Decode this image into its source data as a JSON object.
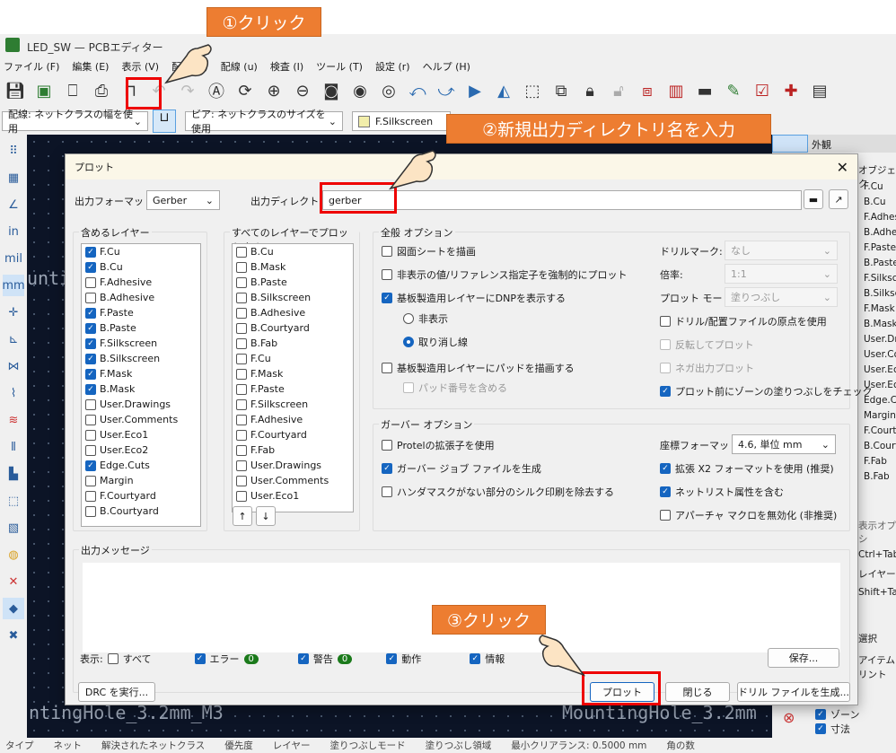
{
  "window": {
    "title": "LED_SW — PCBエディター"
  },
  "menu": [
    "ファイル (F)",
    "編集 (E)",
    "表示 (V)",
    "配置 (P)",
    "配線 (u)",
    "検査 (I)",
    "ツール (T)",
    "設定 (r)",
    "ヘルプ (H)"
  ],
  "toolbar2": {
    "track": "配線: ネットクラスの幅を使用",
    "via": "ビア: ネットクラスのサイズを使用",
    "layer": "F.Silkscreen",
    "layer_color": "#f2eeaa"
  },
  "left_toolbar": {
    "in": "in",
    "mil": "mil",
    "mm": "mm"
  },
  "canvas": {
    "label_left": "ntingHole_3.2mm_M3",
    "label_right": "MountingHole_3.2mm",
    "label_top": "unti"
  },
  "right_panel": {
    "header": "外観",
    "tab": "オブジェク",
    "layers": [
      "F.Cu",
      "B.Cu",
      "F.Adhes",
      "B.Adhes",
      "F.Paste",
      "B.Paste",
      "F.Silkscr",
      "B.Silksc",
      "F.Mask",
      "B.Mask",
      "User.Dr",
      "User.Co",
      "User.Ec",
      "User.Ec",
      "Edge.Cu",
      "Margin",
      "F.Courty",
      "B.Court",
      "F.Fab",
      "B.Fab"
    ],
    "display_opts": "表示オプシ",
    "ctrl_tab": "Ctrl+Tab",
    "layer": "レイヤー",
    "shift_tab": "Shift+Ta",
    "select": "選択",
    "items": "アイテム",
    "print": "リント",
    "zone": "ゾーン",
    "dim": "寸法"
  },
  "status": [
    "タイプ",
    "ネット",
    "解決されたネットクラス",
    "優先度",
    "レイヤー",
    "塗りつぶしモード",
    "塗りつぶし領域",
    "最小クリアランス: 0.5000 mm",
    "角の数"
  ],
  "dialog": {
    "title": "プロット",
    "format_label": "出力フォーマット:",
    "format": "Gerber",
    "dir_label": "出力ディレクトリ:",
    "dir": "gerber",
    "include_layers": {
      "label": "含めるレイヤー",
      "items": [
        {
          "name": "F.Cu",
          "checked": true
        },
        {
          "name": "B.Cu",
          "checked": true
        },
        {
          "name": "F.Adhesive",
          "checked": false
        },
        {
          "name": "B.Adhesive",
          "checked": false
        },
        {
          "name": "F.Paste",
          "checked": true
        },
        {
          "name": "B.Paste",
          "checked": true
        },
        {
          "name": "F.Silkscreen",
          "checked": true
        },
        {
          "name": "B.Silkscreen",
          "checked": true
        },
        {
          "name": "F.Mask",
          "checked": true
        },
        {
          "name": "B.Mask",
          "checked": true
        },
        {
          "name": "User.Drawings",
          "checked": false
        },
        {
          "name": "User.Comments",
          "checked": false
        },
        {
          "name": "User.Eco1",
          "checked": false
        },
        {
          "name": "User.Eco2",
          "checked": false
        },
        {
          "name": "Edge.Cuts",
          "checked": true
        },
        {
          "name": "Margin",
          "checked": false
        },
        {
          "name": "F.Courtyard",
          "checked": false
        },
        {
          "name": "B.Courtyard",
          "checked": false
        }
      ]
    },
    "all_layers": {
      "label": "すべてのレイヤーでプロットする",
      "items": [
        "B.Cu",
        "B.Mask",
        "B.Paste",
        "B.Silkscreen",
        "B.Adhesive",
        "B.Courtyard",
        "B.Fab",
        "F.Cu",
        "F.Mask",
        "F.Paste",
        "F.Silkscreen",
        "F.Adhesive",
        "F.Courtyard",
        "F.Fab",
        "User.Drawings",
        "User.Comments",
        "User.Eco1"
      ]
    },
    "general": {
      "label": "全般 オプション",
      "sheet": "図面シートを描画",
      "force": "非表示の値/リファレンス指定子を強制的にプロット",
      "dnp": "基板製造用レイヤーにDNPを表示する",
      "hide": "非表示",
      "strike": "取り消し線",
      "pads": "基板製造用レイヤーにパッドを描画する",
      "padnum": "パッド番号を含める",
      "drill_label": "ドリルマーク:",
      "drill": "なし",
      "scale_label": "倍率:",
      "scale": "1:1",
      "mode_label": "プロット モード:",
      "mode": "塗りつぶし",
      "origin": "ドリル/配置ファイルの原点を使用",
      "mirror": "反転してプロット",
      "negative": "ネガ出力プロット",
      "zone_check": "プロット前にゾーンの塗りつぶしをチェック"
    },
    "gerber": {
      "label": "ガーバー オプション",
      "protel": "Protelの拡張子を使用",
      "job": "ガーバー ジョブ ファイルを生成",
      "silk": "ハンダマスクがない部分のシルク印刷を除去する",
      "coord_label": "座標フォーマット:",
      "coord": "4.6, 単位 mm",
      "x2": "拡張 X2 フォーマットを使用 (推奨)",
      "netlist": "ネットリスト属性を含む",
      "aperture": "アパーチャ マクロを無効化 (非推奨)"
    },
    "messages": {
      "label": "出力メッセージ",
      "show": "表示:",
      "all": "すべて",
      "error": "エラー",
      "error_count": "0",
      "warn": "警告",
      "warn_count": "0",
      "action": "動作",
      "info": "情報",
      "save": "保存..."
    },
    "buttons": {
      "drc": "DRC を実行...",
      "plot": "プロット",
      "close": "閉じる",
      "drill": "ドリル ファイルを生成..."
    }
  },
  "annotations": {
    "step1": "①クリック",
    "step2": "②新規出力ディレクトリ名を入力",
    "step3": "③クリック",
    "color": "#ed7d31",
    "box_color": "#e00000"
  }
}
